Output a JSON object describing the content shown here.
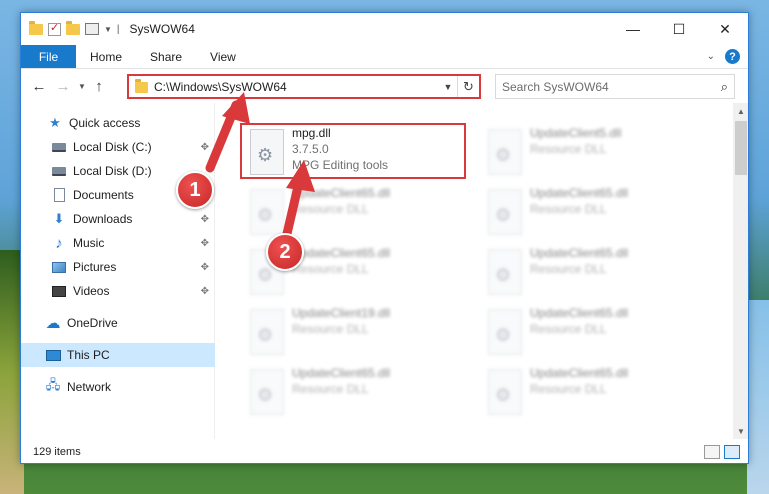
{
  "window": {
    "title": "SysWOW64",
    "controls": {
      "minimize": "—",
      "maximize": "☐",
      "close": "✕"
    }
  },
  "ribbon": {
    "tabs": [
      "File",
      "Home",
      "Share",
      "View"
    ],
    "help": "?",
    "collapse": "⌄"
  },
  "nav": {
    "back": "←",
    "forward": "→",
    "recent": "⌄",
    "up": "↑"
  },
  "address": {
    "path": "C:\\Windows\\SysWOW64",
    "dropdown": "⌄",
    "refresh": "↻"
  },
  "search": {
    "placeholder": "Search SysWOW64",
    "icon": "search-icon"
  },
  "sidebar": {
    "items": [
      {
        "label": "Quick access",
        "icon": "star-icon",
        "pinned": false
      },
      {
        "label": "Local Disk (C:)",
        "icon": "drive-icon",
        "pinned": true
      },
      {
        "label": "Local Disk (D:)",
        "icon": "drive-icon",
        "pinned": false
      },
      {
        "label": "Documents",
        "icon": "documents-icon",
        "pinned": true
      },
      {
        "label": "Downloads",
        "icon": "download-icon",
        "pinned": true
      },
      {
        "label": "Music",
        "icon": "music-icon",
        "pinned": true
      },
      {
        "label": "Pictures",
        "icon": "pictures-icon",
        "pinned": true
      },
      {
        "label": "Videos",
        "icon": "video-icon",
        "pinned": true
      },
      {
        "label": "OneDrive",
        "icon": "cloud-icon",
        "pinned": false
      },
      {
        "label": "This PC",
        "icon": "pc-icon",
        "pinned": false,
        "selected": true
      },
      {
        "label": "Network",
        "icon": "network-icon",
        "pinned": false
      }
    ],
    "pin_glyph": "📌"
  },
  "files": {
    "highlighted": {
      "name": "mpg.dll",
      "version": "3.7.5.0",
      "description": "MPG Editing tools"
    },
    "blurred": [
      {
        "name": "UpdateClient5.dll",
        "type": "Resource DLL"
      },
      {
        "name": "UpdateClient65.dll",
        "type": "Resource DLL"
      },
      {
        "name": "UpdateClient65.dll",
        "type": "Resource DLL"
      },
      {
        "name": "UpdateClient65.dll",
        "type": "Resource DLL"
      },
      {
        "name": "UpdateClient65.dll",
        "type": "Resource DLL"
      },
      {
        "name": "UpdateClient19.dll",
        "type": "Resource DLL"
      },
      {
        "name": "UpdateClient65.dll",
        "type": "Resource DLL"
      },
      {
        "name": "UpdateClient65.dll",
        "type": "Resource DLL"
      },
      {
        "name": "UpdateClient65.dll",
        "type": "Resource DLL"
      }
    ]
  },
  "status": {
    "item_count": "129 items"
  },
  "annotations": {
    "marker1": "1",
    "marker2": "2",
    "accent": "#d9393a"
  }
}
